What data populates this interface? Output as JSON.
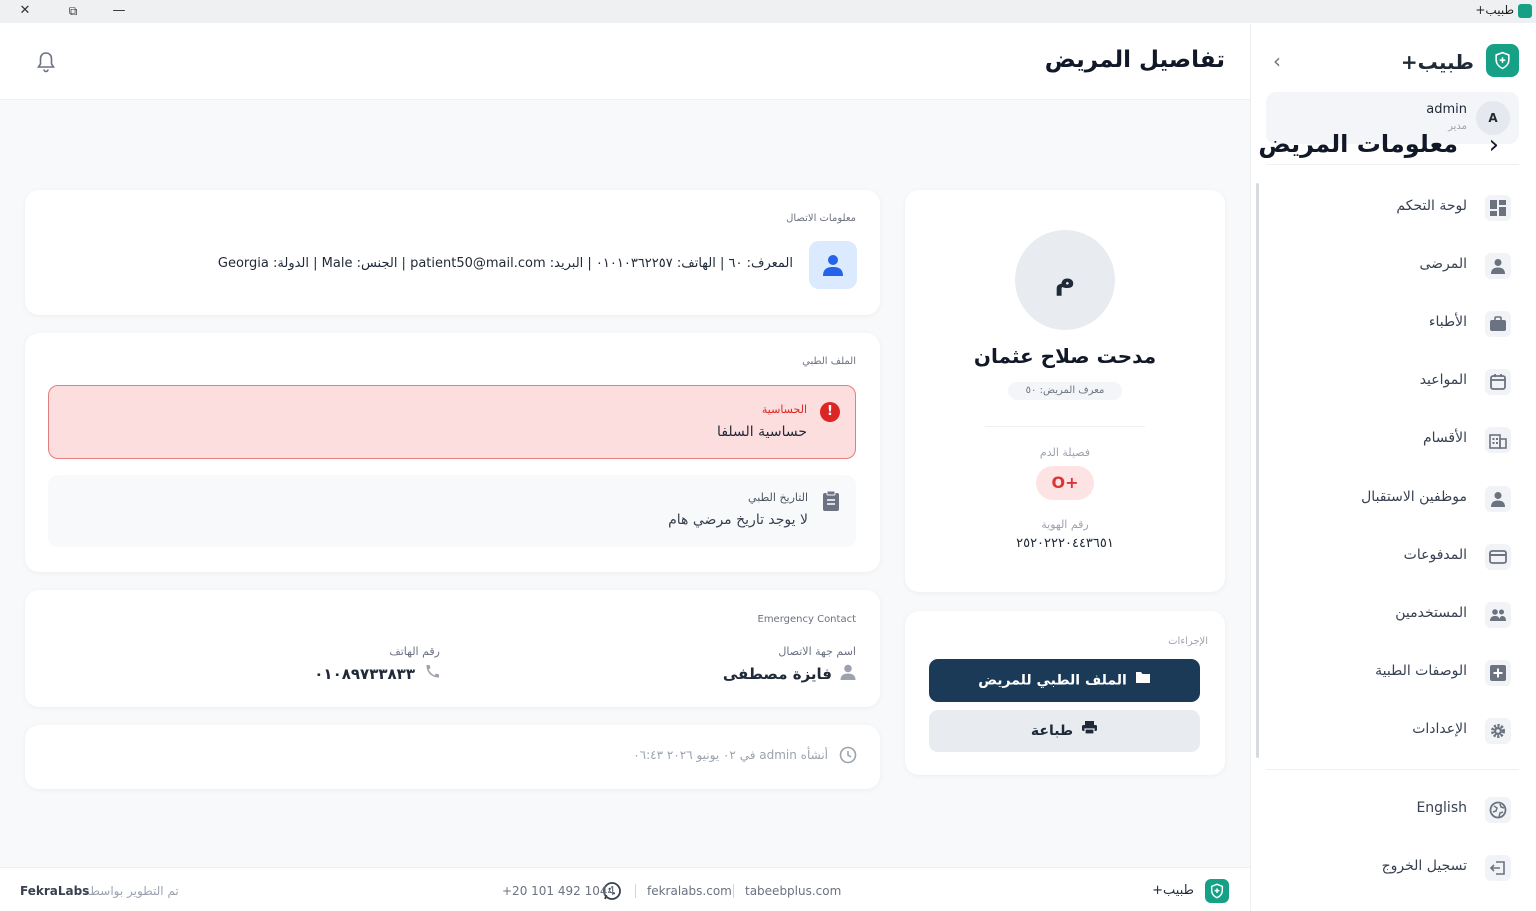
{
  "window": {
    "title": "طبيب+",
    "close": "✕",
    "restore": "⧉",
    "minimize": "—"
  },
  "sidebar": {
    "brand": "طبيب+",
    "user": {
      "initial": "A",
      "name": "admin",
      "role": "مدير"
    },
    "items": [
      {
        "label": "لوحة التحكم",
        "icon": "dashboard-icon"
      },
      {
        "label": "المرضى",
        "icon": "user-icon"
      },
      {
        "label": "الأطباء",
        "icon": "briefcase-icon"
      },
      {
        "label": "المواعيد",
        "icon": "calendar-icon"
      },
      {
        "label": "الأقسام",
        "icon": "building-icon"
      },
      {
        "label": "موظفين الاستقبال",
        "icon": "user-icon"
      },
      {
        "label": "المدفوعات",
        "icon": "credit-card-icon"
      },
      {
        "label": "المستخدمين",
        "icon": "users-icon"
      },
      {
        "label": "الوصفات الطبية",
        "icon": "plus-square-icon"
      },
      {
        "label": "الإعدادات",
        "icon": "gear-icon"
      }
    ],
    "language": "English",
    "logout": "تسجيل الخروج"
  },
  "header": {
    "title": "تفاصيل المريض"
  },
  "section": {
    "title": "معلومات المريض"
  },
  "profile": {
    "initial": "م",
    "name": "مدحت صلاح عثمان",
    "id_label": "معرف المريض: ٥٠",
    "blood_label": "فصيلة الدم",
    "blood_type": "O+",
    "national_id_label": "رقم الهوية",
    "national_id": "٢٥٢٠٢٢٢٠٤٤٣٦٥١"
  },
  "actions": {
    "label": "الإجراءات",
    "medical_file": "الملف الطبي للمريض",
    "print": "طباعة"
  },
  "contact": {
    "label": "معلومات الاتصال",
    "text": "المعرف: ٦٠ | الهاتف: ٠١٠١٠٣٦٢٢٥٧ | البريد: patient50@mail.com | الجنس: Male | الدولة: Georgia"
  },
  "medical": {
    "label": "الملف الطبي",
    "allergy_title": "الحساسية",
    "allergy_text": "حساسية السلفا",
    "history_title": "التاريخ الطبي",
    "history_text": "لا يوجد تاريخ مرضي هام"
  },
  "emergency": {
    "label": "Emergency Contact",
    "name_label": "اسم جهة الاتصال",
    "name": "فايزة مصطفى",
    "phone_label": "رقم الهاتف",
    "phone": "٠١٠٨٩٧٣٣٨٣٣"
  },
  "created": {
    "text": "أنشأه admin في ٠٢ يونيو ٢٠٢٦ ٠٦:٤٣"
  },
  "footer": {
    "brand": "طبيب+",
    "site1": "tabeebplus.com",
    "site2": "fekralabs.com",
    "phone": "+20 101 492 1044",
    "developed_by": "تم التطوير بواسطة",
    "company": "FekraLabs"
  },
  "colors": {
    "accent": "#16a085",
    "primary_button": "#1a3a57",
    "danger": "#dc2626",
    "allergy_bg": "#fcdede"
  }
}
